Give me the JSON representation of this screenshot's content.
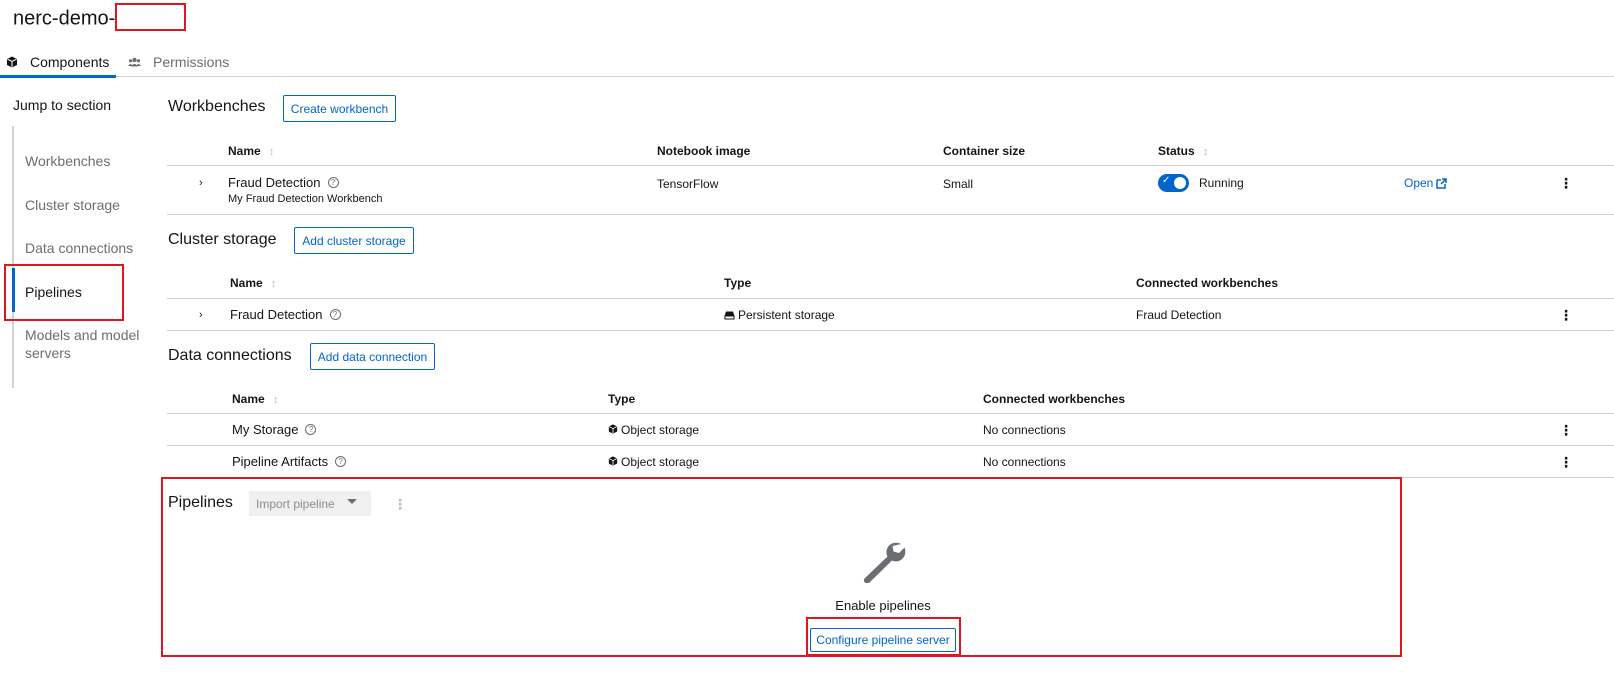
{
  "header": {
    "project_title": "nerc-demo-"
  },
  "tabs": [
    {
      "label": "Components",
      "icon": "cube-icon",
      "active": true
    },
    {
      "label": "Permissions",
      "icon": "users-icon",
      "active": false
    }
  ],
  "jump": {
    "title": "Jump to section",
    "items": [
      {
        "label": "Workbenches"
      },
      {
        "label": "Cluster storage"
      },
      {
        "label": "Data connections"
      },
      {
        "label": "Pipelines",
        "active": true
      },
      {
        "label": "Models and model servers"
      }
    ]
  },
  "workbenches": {
    "title": "Workbenches",
    "button": "Create workbench",
    "columns": [
      "Name",
      "Notebook image",
      "Container size",
      "Status"
    ],
    "rows": [
      {
        "name": "Fraud Detection",
        "description": "My Fraud Detection Workbench",
        "image": "TensorFlow",
        "size": "Small",
        "status": "Running",
        "open": "Open"
      }
    ]
  },
  "cluster_storage": {
    "title": "Cluster storage",
    "button": "Add cluster storage",
    "columns": [
      "Name",
      "Type",
      "Connected workbenches"
    ],
    "rows": [
      {
        "name": "Fraud Detection",
        "type": "Persistent storage",
        "connected": "Fraud Detection"
      }
    ]
  },
  "data_connections": {
    "title": "Data connections",
    "button": "Add data connection",
    "columns": [
      "Name",
      "Type",
      "Connected workbenches"
    ],
    "rows": [
      {
        "name": "My Storage",
        "type": "Object storage",
        "connected": "No connections"
      },
      {
        "name": "Pipeline Artifacts",
        "type": "Object storage",
        "connected": "No connections"
      }
    ]
  },
  "pipelines": {
    "title": "Pipelines",
    "import_select": "Import pipeline",
    "empty_title": "Enable pipelines",
    "configure_button": "Configure pipeline server"
  },
  "colors": {
    "accent": "#0066cc",
    "highlight": "#e0161f"
  }
}
